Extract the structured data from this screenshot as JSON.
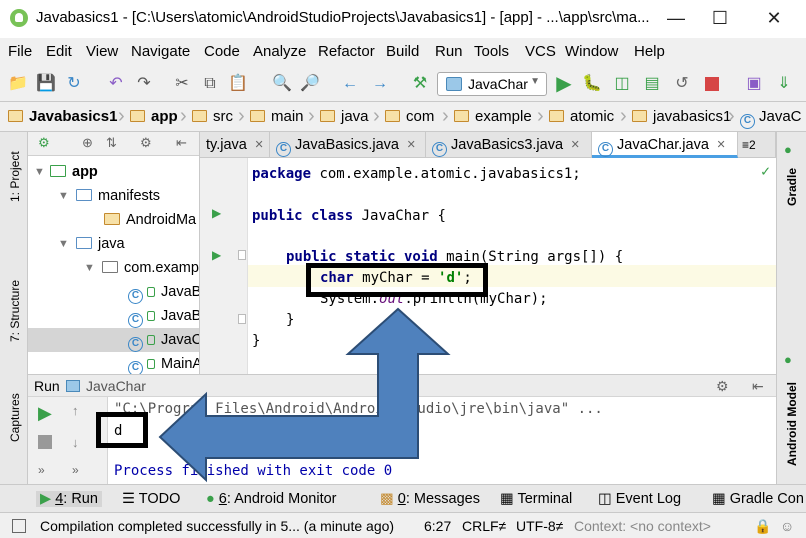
{
  "window": {
    "title": "Javabasics1 - [C:\\Users\\atomic\\AndroidStudioProjects\\Javabasics1] - [app] - ...\\app\\src\\ma...",
    "minimize": "—",
    "maximize": "☐",
    "close": "✕"
  },
  "menu": [
    "File",
    "Edit",
    "View",
    "Navigate",
    "Code",
    "Analyze",
    "Refactor",
    "Build",
    "Run",
    "Tools",
    "VCS",
    "Window",
    "Help"
  ],
  "toolbar": {
    "run_config": "JavaChar"
  },
  "breadcrumb": [
    "Javabasics1",
    "app",
    "src",
    "main",
    "java",
    "com",
    "example",
    "atomic",
    "javabasics1",
    "JavaC"
  ],
  "left_strip": {
    "project": "1: Project",
    "structure": "7: Structure",
    "captures": "Captures"
  },
  "right_strip": {
    "gradle": "Gradle",
    "android_model": "Android Model"
  },
  "project_tree": [
    {
      "label": "app",
      "level": 0,
      "kind": "module"
    },
    {
      "label": "manifests",
      "level": 1,
      "kind": "folder"
    },
    {
      "label": "AndroidMa",
      "level": 2,
      "kind": "file"
    },
    {
      "label": "java",
      "level": 1,
      "kind": "folder"
    },
    {
      "label": "com.examp",
      "level": 2,
      "kind": "package"
    },
    {
      "label": "JavaB",
      "level": 3,
      "kind": "class"
    },
    {
      "label": "JavaB",
      "level": 3,
      "kind": "class"
    },
    {
      "label": "JavaC",
      "level": 3,
      "kind": "class",
      "selected": true
    },
    {
      "label": "MainA",
      "level": 3,
      "kind": "class"
    }
  ],
  "tabs": [
    {
      "label": "ty.java",
      "close": "×"
    },
    {
      "label": "JavaBasics.java",
      "close": "×"
    },
    {
      "label": "JavaBasics3.java",
      "close": "×"
    },
    {
      "label": "JavaChar.java",
      "close": "×",
      "active": true
    },
    {
      "label": "≡2",
      "close": ""
    }
  ],
  "code": {
    "line1_kw": "package",
    "line1_rest": " com.example.atomic.javabasics1;",
    "line2_kw": "public class",
    "line2_rest": " JavaChar {",
    "line3_kw": "public static void",
    "line3_rest": " main(String args[]) {",
    "line4_kw": "char",
    "line4_mid": " myChar = ",
    "line4_str": "'d'",
    "line4_end": ";",
    "line5_a": "System.",
    "line5_field": "out",
    "line5_b": ".println(myChar);",
    "line6": "}",
    "line7": "}"
  },
  "run_panel": {
    "label": "Run",
    "config": "JavaChar",
    "cmd": "\"C:\\Program Files\\Android\\Android Studio\\jre\\bin\\java\" ...",
    "output": "d",
    "exit": "Process finished with exit code 0"
  },
  "bottom_tabs": [
    {
      "num": "4",
      "label": ": Run"
    },
    {
      "num": "",
      "label": "TODO"
    },
    {
      "num": "6",
      "label": ": Android Monitor"
    },
    {
      "num": "0",
      "label": ": Messages"
    },
    {
      "num": "",
      "label": "Terminal"
    },
    {
      "num": "",
      "label": "Event Log"
    },
    {
      "num": "",
      "label": "Gradle Con"
    }
  ],
  "status": {
    "message": "Compilation completed successfully in 5... (a minute ago)",
    "position": "6:27",
    "line_sep": "CRLF≠",
    "encoding": "UTF-8≠",
    "context": "Context: <no context>"
  },
  "colors": {
    "keyword": "#000080",
    "string": "#008000",
    "field": "#660e7a",
    "arrow_fill": "#4f81bd",
    "arrow_stroke": "#2c4d75",
    "run_green": "#3aa04a"
  }
}
